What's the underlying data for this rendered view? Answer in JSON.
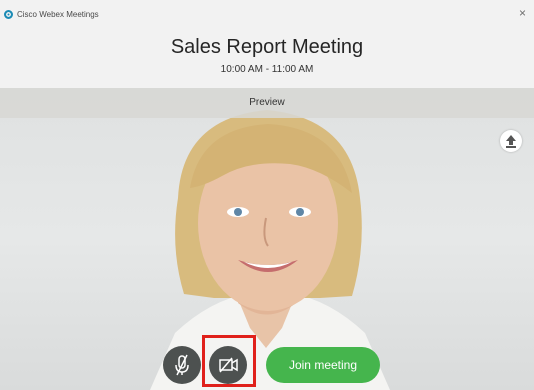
{
  "window": {
    "app_name": "Cisco Webex Meetings",
    "close_glyph": "×"
  },
  "meeting": {
    "title": "Sales Report Meeting",
    "time": "10:00 AM - 11:00 AM"
  },
  "preview": {
    "label": "Preview"
  },
  "controls": {
    "mute_icon": "microphone-off-icon",
    "video_icon": "video-off-icon",
    "join_label": "Join meeting"
  },
  "side_button": {
    "icon": "layout-icon"
  },
  "colors": {
    "join": "#45b54d",
    "control": "#4d5150",
    "highlight": "#e0201b"
  }
}
